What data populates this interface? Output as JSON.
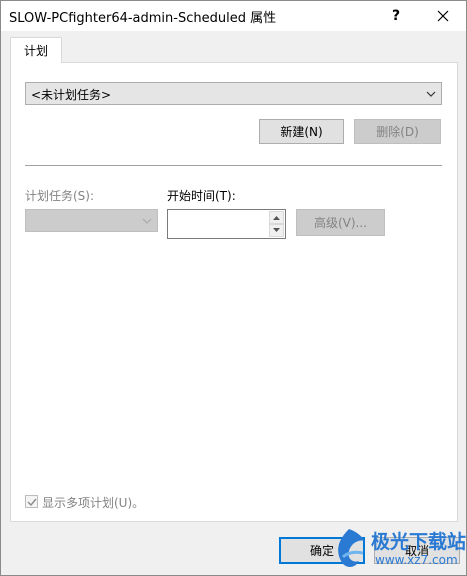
{
  "window": {
    "title": "SLOW-PCfighter64-admin-Scheduled 属性",
    "help_glyph": "?",
    "close_icon": "close-icon"
  },
  "tabs": [
    {
      "label": "计划",
      "selected": true
    }
  ],
  "schedule_combo": {
    "value": "<未计划任务>"
  },
  "buttons": {
    "new_label": "新建(N)",
    "delete_label": "删除(D)",
    "advanced_label": "高级(V)...",
    "ok_label": "确定",
    "cancel_label": "取消"
  },
  "fields": {
    "schedule_task_label": "计划任务(S):",
    "start_time_label": "开始时间(T):",
    "schedule_task_value": "",
    "start_time_value": ""
  },
  "show_multiple": {
    "label": "显示多项计划(U)。",
    "checked": true
  },
  "watermark": {
    "text": "极光下载站",
    "url": "www.xz7.com"
  },
  "colors": {
    "accent": "#0078d7",
    "window_bg": "#f0f0f0",
    "disabled_text": "#838383",
    "watermark": "#2a7ad4"
  }
}
